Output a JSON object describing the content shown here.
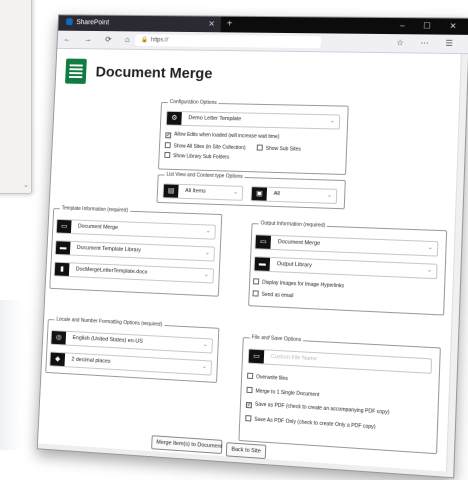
{
  "browser": {
    "tab_title": "SharePoint",
    "new_tab_symbol": "+",
    "window_controls": "– ☐ ✕",
    "nav_buttons": "← → ⟳ ⌂",
    "url": "https://",
    "right_icons": "☆ ⋯ ☰"
  },
  "app": {
    "title": "Document Merge"
  },
  "config": {
    "legend": "Configuration Options",
    "template_select": "Demo Letter Template",
    "allow_edits": "Allow Edits when loaded (will increase wait time)",
    "show_all_sites": "Show All Sites (in Site Collection)",
    "show_sub_sites": "Show Sub Sites",
    "show_library_sub_folders": "Show Library Sub Folders"
  },
  "list_view": {
    "legend": "List View and Content type Options",
    "view_select": "All Items",
    "content_type_select": "All"
  },
  "template_info": {
    "legend": "Template Information (required)",
    "site": "Document Merge",
    "library": "Document Template Library",
    "file": "DocMergeLetterTemplate.docx"
  },
  "output_info": {
    "legend": "Output Information (required)",
    "site": "Document Merge",
    "library": "Output Library",
    "display_images": "Display Images for Image Hyperlinks",
    "send_email": "Send as email"
  },
  "locale": {
    "legend": "Locale and Number Formatting Options (required)",
    "language": "English (United States) en-US",
    "decimals": "2 decimal places"
  },
  "file_save": {
    "legend": "File and Save Options",
    "file_name_placeholder": "Custom File Name",
    "overwrite": "Overwrite files",
    "merge_single": "Merge to 1 Single Document",
    "save_pdf": "Save as PDF (check to create an accompanying PDF copy)",
    "save_pdf_only": "Save As PDF Only (check to create Only a PDF copy)"
  },
  "actions": {
    "merge": "Merge Item(s) to Document",
    "back": "Back to Site"
  },
  "background": {
    "scroll_glyph": "⌄"
  }
}
